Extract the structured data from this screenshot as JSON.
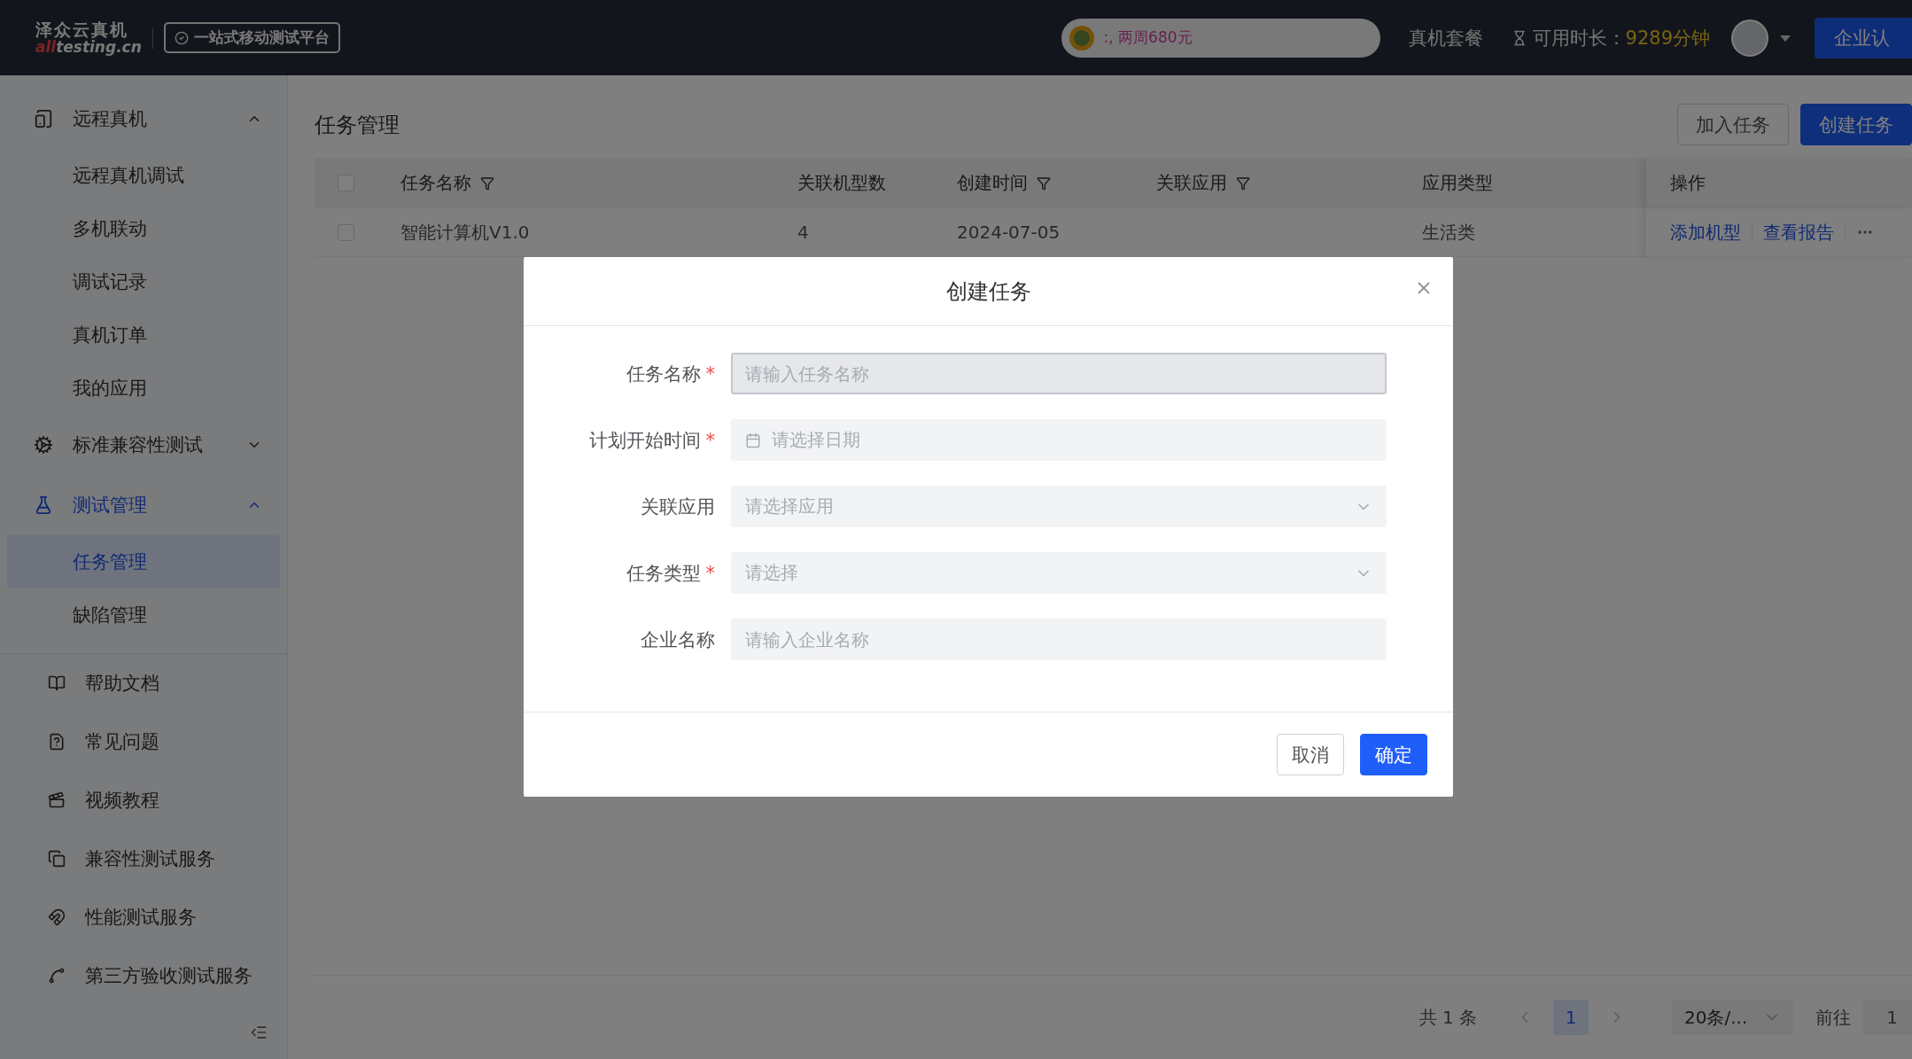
{
  "header": {
    "logo": {
      "name": "泽众云真机",
      "domain_accent": "all",
      "domain": "testing.cn"
    },
    "slogan": "一站式移动测试平台",
    "promo": ":, 两周680元",
    "plan_link": "真机套餐",
    "time_label": "可用时长：",
    "time_value": "9289分钟",
    "cert_button": "企业认"
  },
  "sidebar": {
    "groups": [
      {
        "label": "远程真机",
        "expanded": true,
        "selected": false,
        "children": [
          {
            "label": "远程真机调试",
            "selected": false
          },
          {
            "label": "多机联动",
            "selected": false
          },
          {
            "label": "调试记录",
            "selected": false
          },
          {
            "label": "真机订单",
            "selected": false
          },
          {
            "label": "我的应用",
            "selected": false
          }
        ]
      },
      {
        "label": "标准兼容性测试",
        "expanded": false,
        "selected": false
      },
      {
        "label": "测试管理",
        "expanded": true,
        "selected": true,
        "children": [
          {
            "label": "任务管理",
            "selected": true
          },
          {
            "label": "缺陷管理",
            "selected": false
          }
        ]
      }
    ],
    "links": [
      "帮助文档",
      "常见问题",
      "视频教程",
      "兼容性测试服务",
      "性能测试服务",
      "第三方验收测试服务"
    ]
  },
  "page": {
    "title": "任务管理",
    "buttons": [
      {
        "label": "加入任务",
        "kind": "secondary"
      },
      {
        "label": "创建任务",
        "kind": "primary"
      }
    ]
  },
  "table": {
    "header_checked": false,
    "columns": [
      {
        "label": "任务名称",
        "filter": true
      },
      {
        "label": "关联机型数",
        "filter": false
      },
      {
        "label": "创建时间",
        "filter": true
      },
      {
        "label": "关联应用",
        "filter": true
      },
      {
        "label": "应用类型",
        "filter": false
      }
    ],
    "actions_column": "操作",
    "rows": [
      {
        "checked": false,
        "cells": [
          "智能计算机V1.0",
          "4",
          "2024-07-05",
          null,
          "生活类"
        ],
        "actions": [
          "添加机型",
          "查看报告"
        ]
      }
    ]
  },
  "pagination": {
    "total": "共 1 条",
    "pages": [
      {
        "label": "1",
        "selected": true
      }
    ],
    "page_size": "20条/...",
    "goto_label": "前往",
    "goto_value": "1"
  },
  "dialog": {
    "title": "创建任务",
    "fields": [
      {
        "label": "任务名称",
        "kind": "input",
        "required_mark": "*",
        "focused": true,
        "placeholder": "请输入任务名称"
      },
      {
        "label": "计划开始时间",
        "kind": "date",
        "required_mark": "*",
        "focused": false,
        "placeholder": "请选择日期"
      },
      {
        "label": "关联应用",
        "kind": "select",
        "focused": false,
        "placeholder": "请选择应用"
      },
      {
        "label": "任务类型",
        "kind": "select",
        "required_mark": "*",
        "focused": false,
        "placeholder": "请选择"
      },
      {
        "label": "企业名称",
        "kind": "input",
        "focused": false,
        "placeholder": "请输入企业名称"
      }
    ],
    "buttons": [
      {
        "label": "取消",
        "kind": "secondary"
      },
      {
        "label": "确定",
        "kind": "primary"
      }
    ]
  }
}
